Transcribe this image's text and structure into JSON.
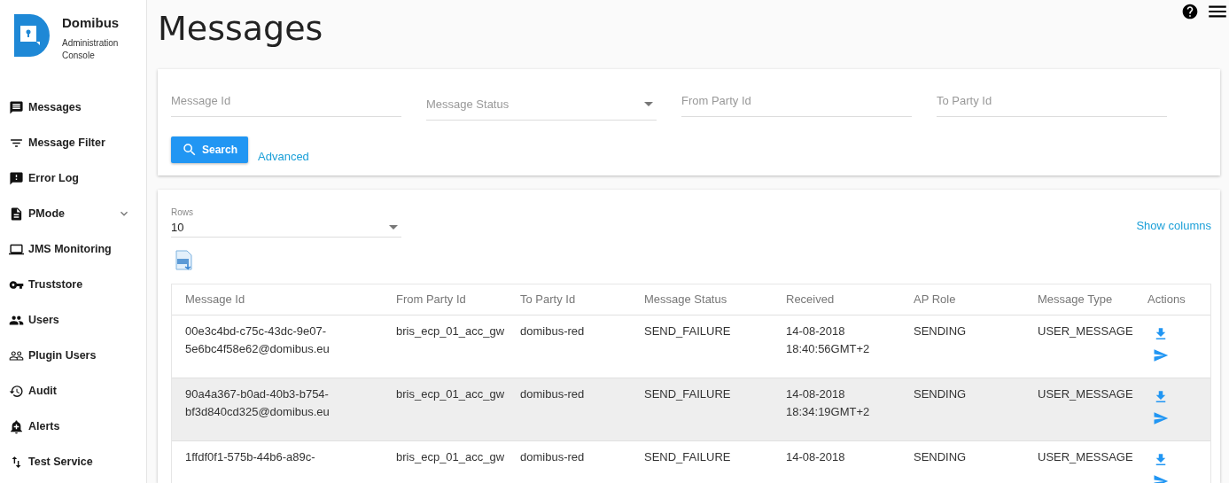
{
  "brand": {
    "name": "Domibus",
    "subtitle": "Administration Console"
  },
  "sidebar": {
    "items": [
      {
        "label": "Messages"
      },
      {
        "label": "Message Filter"
      },
      {
        "label": "Error Log"
      },
      {
        "label": "PMode",
        "expanded": false
      },
      {
        "label": "JMS Monitoring"
      },
      {
        "label": "Truststore"
      },
      {
        "label": "Users"
      },
      {
        "label": "Plugin Users"
      },
      {
        "label": "Audit"
      },
      {
        "label": "Alerts"
      },
      {
        "label": "Test Service"
      }
    ]
  },
  "page_title": "Messages",
  "filters": {
    "fields": [
      {
        "placeholder": "Message Id",
        "kind": "text"
      },
      {
        "placeholder": "Message Status",
        "kind": "select"
      },
      {
        "placeholder": "From Party Id",
        "kind": "text"
      },
      {
        "placeholder": "To Party Id",
        "kind": "text"
      }
    ],
    "search_button": "Search",
    "advanced_link": "Advanced"
  },
  "results": {
    "rows_label": "Rows",
    "rows_value": "10",
    "show_columns": "Show columns",
    "table": {
      "columns": [
        "Message Id",
        "From Party Id",
        "To Party Id",
        "Message Status",
        "Received",
        "AP Role",
        "Message Type",
        "Actions"
      ],
      "rows": [
        {
          "selected": false,
          "cells": [
            "00e3c4bd-c75c-43dc-9e07-5e6bc4f58e62@domibus.eu",
            "bris_ecp_01_acc_gw",
            "domibus-red",
            "SEND_FAILURE",
            "14-08-2018 18:40:56GMT+2",
            "SENDING",
            "USER_MESSAGE"
          ]
        },
        {
          "selected": true,
          "cells": [
            "90a4a367-b0ad-40b3-b754-bf3d840cd325@domibus.eu",
            "bris_ecp_01_acc_gw",
            "domibus-red",
            "SEND_FAILURE",
            "14-08-2018 18:34:19GMT+2",
            "SENDING",
            "USER_MESSAGE"
          ]
        },
        {
          "selected": false,
          "cells": [
            "1ffdf0f1-575b-44b6-a89c-",
            "bris_ecp_01_acc_gw",
            "domibus-red",
            "SEND_FAILURE",
            "14-08-2018",
            "SENDING",
            "USER_MESSAGE"
          ]
        }
      ]
    }
  }
}
